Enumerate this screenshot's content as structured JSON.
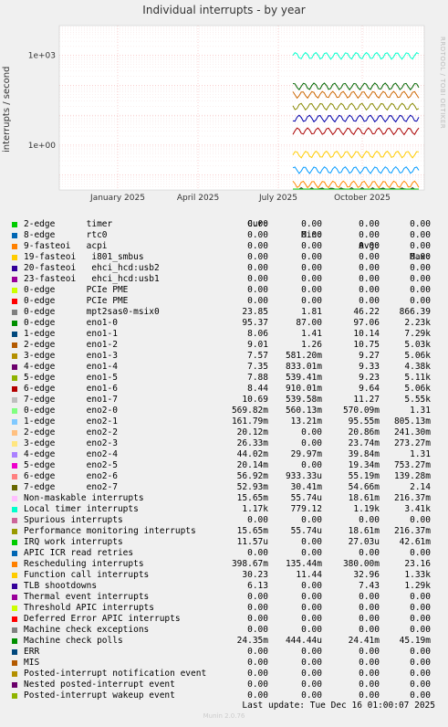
{
  "page": {
    "title": "Individual interrupts - by year",
    "side_label": "RRDTOOL / TOBI OETIKER",
    "last_update": "Last update: Tue Dec 16 01:00:07 2025",
    "footer": "Munin 2.0.76"
  },
  "legend_header": {
    "cur": "Cur:",
    "min": "Min:",
    "avg": "Avg:",
    "max": "Max:"
  },
  "chart_data": {
    "type": "line",
    "title": "Individual interrupts - by year",
    "ylabel": "interrupts / second",
    "y_scale": "log",
    "y_ticks": [
      "1e-03",
      "1e+00",
      "1e+03"
    ],
    "x_ticks": [
      "January 2025",
      "April 2025",
      "July 2025",
      "October 2025"
    ],
    "grid": true,
    "series_levels": [
      {
        "name": "Local timer interrupts",
        "color": "#00ffcc",
        "level": 1000
      },
      {
        "name": "eno1-0",
        "color": "#006600",
        "level": 95
      },
      {
        "name": "eno2-0",
        "color": "#cc6600",
        "level": 50
      },
      {
        "name": "eno1-3",
        "color": "#888800",
        "level": 20
      },
      {
        "name": "eno1-4",
        "color": "#0000aa",
        "level": 8
      },
      {
        "name": "eno1-6",
        "color": "#aa0000",
        "level": 3
      },
      {
        "name": "Performance monitoring interrupts",
        "color": "#ffcc00",
        "level": 0.5
      },
      {
        "name": "eno2-1",
        "color": "#0099ff",
        "level": 0.15
      },
      {
        "name": "Function call interrupts",
        "color": "#ff8800",
        "level": 0.05
      },
      {
        "name": "mpt2sas0-msix0",
        "color": "#222222",
        "level": 0.03
      },
      {
        "name": "eno2-6",
        "color": "#ff00cc",
        "level": 0.01
      },
      {
        "name": "Machine check polls",
        "color": "#00cc00",
        "level": 1e-05
      }
    ]
  },
  "rows": [
    {
      "name": "2-edge      timer",
      "color": "#00cc00",
      "cur": "0.00",
      "min": "0.00",
      "avg": "0.00",
      "max": "0.00"
    },
    {
      "name": "8-edge      rtc0",
      "color": "#0066b3",
      "cur": "0.00",
      "min": "0.00",
      "avg": "0.00",
      "max": "0.00"
    },
    {
      "name": "9-fasteoi   acpi",
      "color": "#ff8000",
      "cur": "0.00",
      "min": "0.00",
      "avg": "0.00",
      "max": "0.00"
    },
    {
      "name": "19-fasteoi   i801_smbus",
      "color": "#ffcc00",
      "cur": "0.00",
      "min": "0.00",
      "avg": "0.00",
      "max": "0.00"
    },
    {
      "name": "20-fasteoi   ehci_hcd:usb2",
      "color": "#330099",
      "cur": "0.00",
      "min": "0.00",
      "avg": "0.00",
      "max": "0.00"
    },
    {
      "name": "23-fasteoi   ehci_hcd:usb1",
      "color": "#990099",
      "cur": "0.00",
      "min": "0.00",
      "avg": "0.00",
      "max": "0.00"
    },
    {
      "name": "0-edge      PCIe PME",
      "color": "#ccff00",
      "cur": "0.00",
      "min": "0.00",
      "avg": "0.00",
      "max": "0.00"
    },
    {
      "name": "0-edge      PCIe PME",
      "color": "#ff0000",
      "cur": "0.00",
      "min": "0.00",
      "avg": "0.00",
      "max": "0.00"
    },
    {
      "name": "0-edge      mpt2sas0-msix0",
      "color": "#808080",
      "cur": "23.85",
      "min": "1.81",
      "avg": "46.22",
      "max": "866.39"
    },
    {
      "name": "0-edge      eno1-0",
      "color": "#008f00",
      "cur": "95.37",
      "min": "87.00",
      "avg": "97.06",
      "max": "2.23k"
    },
    {
      "name": "1-edge      eno1-1",
      "color": "#00487d",
      "cur": "8.06",
      "min": "1.41",
      "avg": "10.14",
      "max": "7.29k"
    },
    {
      "name": "2-edge      eno1-2",
      "color": "#b35a00",
      "cur": "9.01",
      "min": "1.26",
      "avg": "10.75",
      "max": "5.03k"
    },
    {
      "name": "3-edge      eno1-3",
      "color": "#b38f00",
      "cur": "7.57",
      "min": "581.20m",
      "avg": "9.27",
      "max": "5.06k"
    },
    {
      "name": "4-edge      eno1-4",
      "color": "#6b006b",
      "cur": "7.35",
      "min": "833.01m",
      "avg": "9.33",
      "max": "4.38k"
    },
    {
      "name": "5-edge      eno1-5",
      "color": "#8fb300",
      "cur": "7.88",
      "min": "539.41m",
      "avg": "9.23",
      "max": "5.11k"
    },
    {
      "name": "6-edge      eno1-6",
      "color": "#b30000",
      "cur": "8.44",
      "min": "910.01m",
      "avg": "9.64",
      "max": "5.06k"
    },
    {
      "name": "7-edge      eno1-7",
      "color": "#bebebe",
      "cur": "10.69",
      "min": "539.58m",
      "avg": "11.27",
      "max": "5.55k"
    },
    {
      "name": "0-edge      eno2-0",
      "color": "#80ff80",
      "cur": "569.82m",
      "min": "560.13m",
      "avg": "570.09m",
      "max": "1.31"
    },
    {
      "name": "1-edge      eno2-1",
      "color": "#80c9ff",
      "cur": "161.79m",
      "min": "13.21m",
      "avg": "95.55m",
      "max": "805.13m"
    },
    {
      "name": "2-edge      eno2-2",
      "color": "#ffc080",
      "cur": "20.12m",
      "min": "0.00",
      "avg": "20.86m",
      "max": "241.30m"
    },
    {
      "name": "3-edge      eno2-3",
      "color": "#ffe680",
      "cur": "26.33m",
      "min": "0.00",
      "avg": "23.74m",
      "max": "273.27m"
    },
    {
      "name": "4-edge      eno2-4",
      "color": "#aa80ff",
      "cur": "44.02m",
      "min": "29.97m",
      "avg": "39.84m",
      "max": "1.31"
    },
    {
      "name": "5-edge      eno2-5",
      "color": "#ee00cc",
      "cur": "20.14m",
      "min": "0.00",
      "avg": "19.34m",
      "max": "753.27m"
    },
    {
      "name": "6-edge      eno2-6",
      "color": "#ff8080",
      "cur": "56.92m",
      "min": "933.33u",
      "avg": "55.19m",
      "max": "139.28m"
    },
    {
      "name": "7-edge      eno2-7",
      "color": "#666600",
      "cur": "52.93m",
      "min": "30.41m",
      "avg": "54.66m",
      "max": "2.14"
    },
    {
      "name": "Non-maskable interrupts",
      "color": "#ffbfff",
      "cur": "15.65m",
      "min": "55.74u",
      "avg": "18.61m",
      "max": "216.37m"
    },
    {
      "name": "Local timer interrupts",
      "color": "#00ffcc",
      "cur": "1.17k",
      "min": "779.12",
      "avg": "1.19k",
      "max": "3.41k"
    },
    {
      "name": "Spurious interrupts",
      "color": "#cc6699",
      "cur": "0.00",
      "min": "0.00",
      "avg": "0.00",
      "max": "0.00"
    },
    {
      "name": "Performance monitoring interrupts",
      "color": "#999900",
      "cur": "15.65m",
      "min": "55.74u",
      "avg": "18.61m",
      "max": "216.37m"
    },
    {
      "name": "IRQ work interrupts",
      "color": "#00cc00",
      "cur": "11.57u",
      "min": "0.00",
      "avg": "27.03u",
      "max": "42.61m"
    },
    {
      "name": "APIC ICR read retries",
      "color": "#0066b3",
      "cur": "0.00",
      "min": "0.00",
      "avg": "0.00",
      "max": "0.00"
    },
    {
      "name": "Rescheduling interrupts",
      "color": "#ff8000",
      "cur": "398.67m",
      "min": "135.44m",
      "avg": "380.00m",
      "max": "23.16"
    },
    {
      "name": "Function call interrupts",
      "color": "#ffcc00",
      "cur": "30.23",
      "min": "11.44",
      "avg": "32.96",
      "max": "1.33k"
    },
    {
      "name": "TLB shootdowns",
      "color": "#330099",
      "cur": "6.13",
      "min": "0.00",
      "avg": "7.43",
      "max": "1.29k"
    },
    {
      "name": "Thermal event interrupts",
      "color": "#990099",
      "cur": "0.00",
      "min": "0.00",
      "avg": "0.00",
      "max": "0.00"
    },
    {
      "name": "Threshold APIC interrupts",
      "color": "#ccff00",
      "cur": "0.00",
      "min": "0.00",
      "avg": "0.00",
      "max": "0.00"
    },
    {
      "name": "Deferred Error APIC interrupts",
      "color": "#ff0000",
      "cur": "0.00",
      "min": "0.00",
      "avg": "0.00",
      "max": "0.00"
    },
    {
      "name": "Machine check exceptions",
      "color": "#808080",
      "cur": "0.00",
      "min": "0.00",
      "avg": "0.00",
      "max": "0.00"
    },
    {
      "name": "Machine check polls",
      "color": "#008f00",
      "cur": "24.35m",
      "min": "444.44u",
      "avg": "24.41m",
      "max": "45.19m"
    },
    {
      "name": "ERR",
      "color": "#00487d",
      "cur": "0.00",
      "min": "0.00",
      "avg": "0.00",
      "max": "0.00"
    },
    {
      "name": "MIS",
      "color": "#b35a00",
      "cur": "0.00",
      "min": "0.00",
      "avg": "0.00",
      "max": "0.00"
    },
    {
      "name": "Posted-interrupt notification event",
      "color": "#b38f00",
      "cur": "0.00",
      "min": "0.00",
      "avg": "0.00",
      "max": "0.00"
    },
    {
      "name": "Nested posted-interrupt event",
      "color": "#6b006b",
      "cur": "0.00",
      "min": "0.00",
      "avg": "0.00",
      "max": "0.00"
    },
    {
      "name": "Posted-interrupt wakeup event",
      "color": "#8fb300",
      "cur": "0.00",
      "min": "0.00",
      "avg": "0.00",
      "max": "0.00"
    }
  ]
}
